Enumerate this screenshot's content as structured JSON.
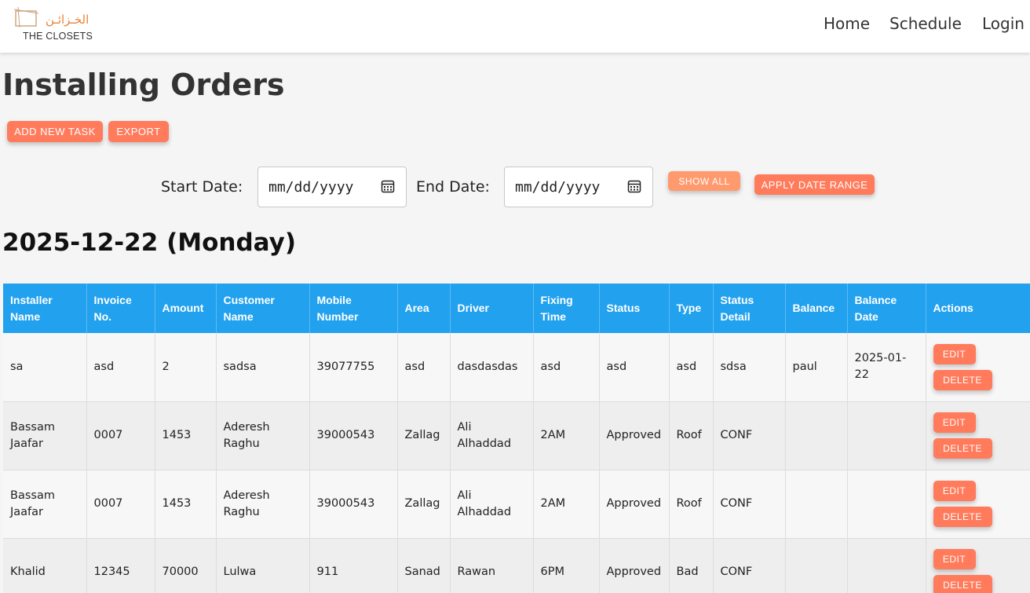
{
  "brand": {
    "arabic": "الخـزائـن",
    "english": "THE CLOSETS"
  },
  "nav": {
    "home": "Home",
    "schedule": "Schedule",
    "login": "Login"
  },
  "page": {
    "title": "Installing Orders",
    "add_button": "ADD NEW TASK",
    "export_button": "EXPORT",
    "start_label": "Start Date:",
    "end_label": "End Date:",
    "date_placeholder": "mm/dd/yyyy",
    "show_all": "SHOW ALL",
    "apply_range": "APPLY DATE RANGE",
    "day_title": "2025-12-22 (Monday)"
  },
  "table": {
    "headers": [
      "Installer Name",
      "Invoice No.",
      "Amount",
      "Customer Name",
      "Mobile Number",
      "Area",
      "Driver",
      "Fixing Time",
      "Status",
      "Type",
      "Status Detail",
      "Balance",
      "Balance Date",
      "Actions"
    ],
    "edit_label": "EDIT",
    "delete_label": "DELETE",
    "rows": [
      [
        "sa",
        "asd",
        "2",
        "sadsa",
        "39077755",
        "asd",
        "dasdasdas",
        "asd",
        "asd",
        "asd",
        "sdsa",
        "paul",
        "2025-01-22"
      ],
      [
        "Bassam Jaafar",
        "0007",
        "1453",
        "Aderesh Raghu",
        "39000543",
        "Zallag",
        "Ali Alhaddad",
        "2AM",
        "Approved",
        "Roof",
        "CONF",
        "",
        ""
      ],
      [
        "Bassam Jaafar",
        "0007",
        "1453",
        "Aderesh Raghu",
        "39000543",
        "Zallag",
        "Ali Alhaddad",
        "2AM",
        "Approved",
        "Roof",
        "CONF",
        "",
        ""
      ],
      [
        "Khalid",
        "12345",
        "70000",
        "Lulwa",
        "911",
        "Sanad",
        "Rawan",
        "6PM",
        "Approved",
        "Bad",
        "CONF",
        "",
        ""
      ]
    ]
  },
  "colors": {
    "accent": "#ff7b5c",
    "header_blue": "#22a1ee",
    "brand_orange": "#e8833a"
  }
}
